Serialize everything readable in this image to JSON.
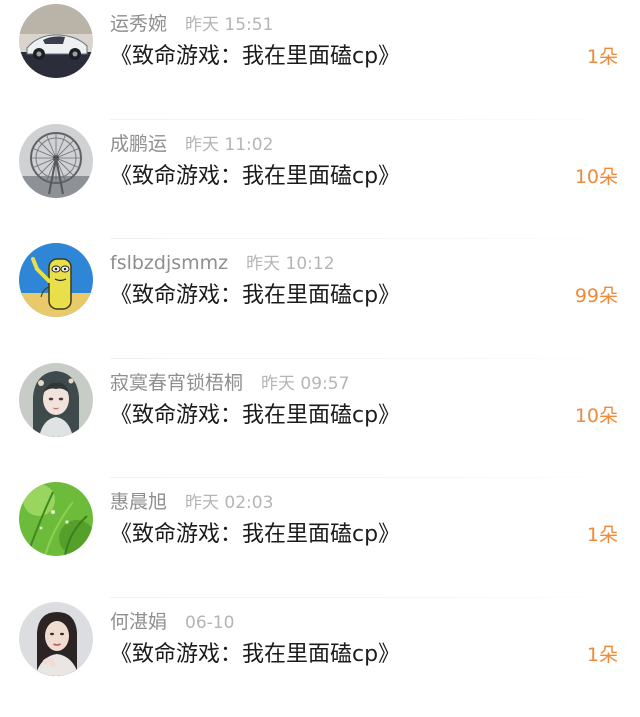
{
  "items": [
    {
      "name": "运秀婉",
      "time": "昨天 15:51",
      "title": "《致命游戏：我在里面磕cp》",
      "count": "1朵",
      "avatar": "car-avatar-icon"
    },
    {
      "name": "成鹏运",
      "time": "昨天 11:02",
      "title": "《致命游戏：我在里面磕cp》",
      "count": "10朵",
      "avatar": "ferris-wheel-avatar-icon"
    },
    {
      "name": "fslbzdjsmmz",
      "time": "昨天 10:12",
      "title": "《致命游戏：我在里面磕cp》",
      "count": "99朵",
      "avatar": "cartoon-avatar-icon"
    },
    {
      "name": "寂寞春宵锁梧桐",
      "time": "昨天 09:57",
      "title": "《致命游戏：我在里面磕cp》",
      "count": "10朵",
      "avatar": "anime-girl-avatar-icon"
    },
    {
      "name": "惠晨旭",
      "time": "昨天 02:03",
      "title": "《致命游戏：我在里面磕cp》",
      "count": "1朵",
      "avatar": "grass-avatar-icon"
    },
    {
      "name": "何湛娟",
      "time": "06-10",
      "title": "《致命游戏：我在里面磕cp》",
      "count": "1朵",
      "avatar": "woman-portrait-avatar-icon"
    }
  ],
  "colors": {
    "accent": "#f08a3a",
    "name": "#8f8f8f",
    "time": "#b5b5b5",
    "title": "#1b1b1b"
  }
}
